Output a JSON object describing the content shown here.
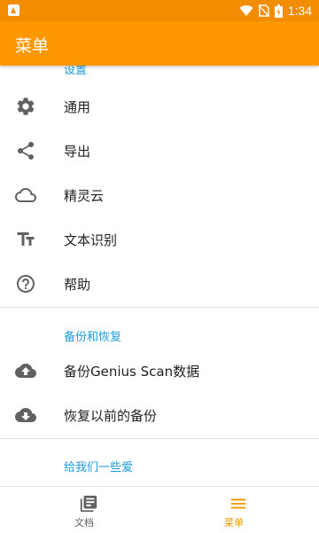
{
  "status_bar": {
    "time": "1:34"
  },
  "app_bar": {
    "title": "菜单"
  },
  "sections": {
    "settings": {
      "header": "设置",
      "items": [
        {
          "label": "通用",
          "icon": "gear-icon"
        },
        {
          "label": "导出",
          "icon": "share-icon"
        },
        {
          "label": "精灵云",
          "icon": "cloud-icon"
        },
        {
          "label": "文本识别",
          "icon": "text-size-icon"
        },
        {
          "label": "帮助",
          "icon": "help-icon"
        }
      ]
    },
    "backup": {
      "header": "备份和恢复",
      "items": [
        {
          "label": "备份Genius Scan数据",
          "icon": "cloud-upload-icon"
        },
        {
          "label": "恢复以前的备份",
          "icon": "cloud-download-icon"
        }
      ]
    },
    "love": {
      "header": "给我们一些爱"
    }
  },
  "bottom_nav": {
    "tabs": [
      {
        "label": "文档",
        "icon": "documents-icon"
      },
      {
        "label": "菜单",
        "icon": "menu-icon"
      }
    ],
    "selected": "菜单"
  },
  "colors": {
    "status_bar": "#f28c00",
    "app_bar": "#ff9800",
    "section_header": "#1e9bd7",
    "active_tab": "#f29600"
  }
}
